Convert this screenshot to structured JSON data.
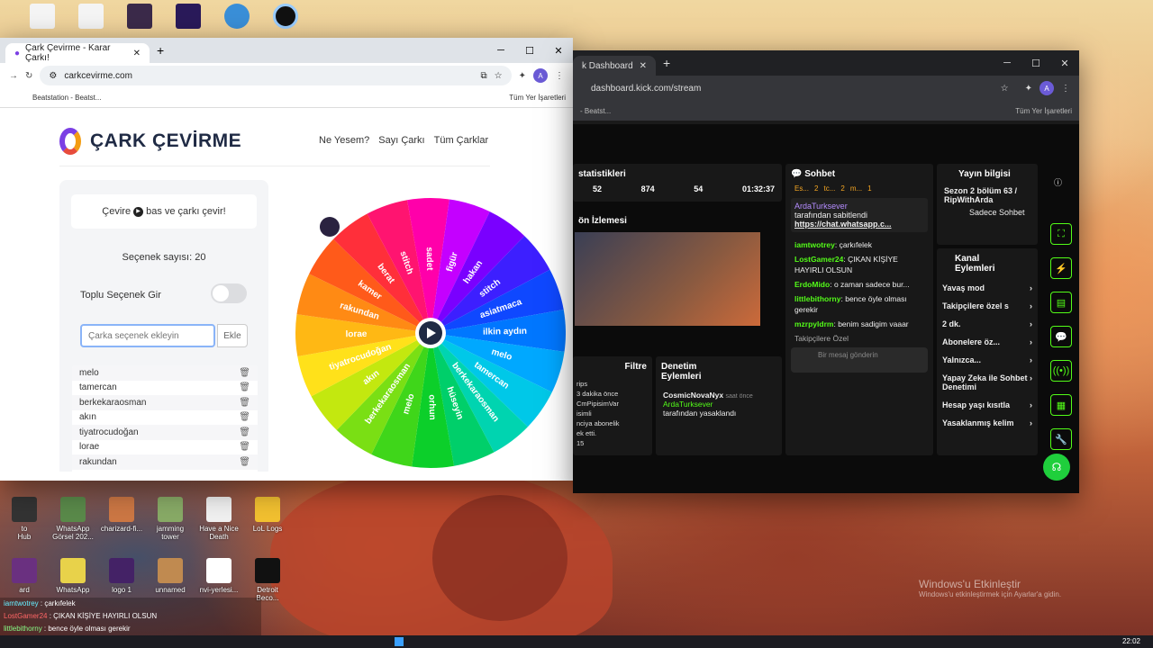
{
  "desktop": {
    "top_icons": [
      "",
      "",
      "",
      "",
      "",
      ""
    ],
    "row1": [
      {
        "label": "to\nHub"
      },
      {
        "label": "WhatsApp\nGörsel 202..."
      },
      {
        "label": "charizard-fi..."
      },
      {
        "label": "jamming\ntower"
      },
      {
        "label": "Have a Nice\nDeath"
      },
      {
        "label": "LoL Logs"
      }
    ],
    "row2": [
      {
        "label": "ard"
      },
      {
        "label": "WhatsApp"
      },
      {
        "label": "logo 1"
      },
      {
        "label": "unnamed"
      },
      {
        "label": "nvi-yerlesi..."
      },
      {
        "label": "Detroit\nBeco..."
      }
    ],
    "watermark_title": "Windows'u Etkinleştir",
    "watermark_sub": "Windows'u etkinleştirmek için Ayarlar'a gidin.",
    "clock": "22:02"
  },
  "stream_overlay": [
    {
      "user": "iamtwotrey",
      "msg": "çarkıfelek",
      "color": "#6ef"
    },
    {
      "user": "LostGamer24",
      "msg": "ÇIKAN KİŞİYE HAYIRLI OLSUN",
      "color": "#f66"
    },
    {
      "user": "littlebithorny",
      "msg": "bence öyle olması gerekir",
      "color": "#8f8"
    },
    {
      "user": "mzrpyldrm",
      "msg": "benim sadigim vaaar",
      "color": "#8cf"
    }
  ],
  "left_window": {
    "tab_title": "Çark Çevirme - Karar Çarkı!",
    "url": "carkcevirme.com",
    "bookmark": "Beatstation - Beatst...",
    "bookmarks_all": "Tüm Yer İşaretleri",
    "site": {
      "logo": "ÇARK ÇEVİRME",
      "nav": [
        "Ne Yesem?",
        "Sayı Çarkı",
        "Tüm Çarklar"
      ],
      "hint_before": "Çevire",
      "hint_after": "bas ve çarkı çevir!",
      "count": "Seçenek sayısı: 20",
      "bulk_label": "Toplu Seçenek Gir",
      "input_placeholder": "Çarka seçenek ekleyin",
      "add_button": "Ekle",
      "options": [
        "melo",
        "tamercan",
        "berkekaraosman",
        "akın",
        "tiyatrocudoğan",
        "lorae",
        "rakundan"
      ],
      "wheel_labels": [
        "sadet",
        "figür",
        "hakan",
        "stitch",
        "asiatmaca",
        "ilkin aydın",
        "melo",
        "tamercan",
        "berkekaraosman",
        "hüseyin",
        "orhun",
        "melo",
        "berkekaraosman",
        "akın",
        "tiyatrocudoğan",
        "lorae",
        "rakundan",
        "kamer",
        "berat",
        "stitch"
      ],
      "wheel_colors": [
        "#ff00aa",
        "#c400ff",
        "#7a00ff",
        "#3d1fff",
        "#0f48ff",
        "#0077ff",
        "#00a8ff",
        "#00c8e8",
        "#00d4b0",
        "#00cf6a",
        "#0ccf2a",
        "#3fd61a",
        "#7adf14",
        "#c3e80f",
        "#ffe11a",
        "#ffb814",
        "#ff8a14",
        "#ff5a1a",
        "#ff2f3a",
        "#ff1470"
      ]
    }
  },
  "right_window": {
    "tab_title": "k Dashboard",
    "url": "dashboard.kick.com/stream",
    "bookmark": "- Beatst...",
    "bookmarks_all": "Tüm Yer İşaretleri",
    "stats_title": "statistikleri",
    "stats": [
      "52",
      "874",
      "54",
      "01:32:37"
    ],
    "preview_title": "ön İzlemesi",
    "chat_title": "Sohbet",
    "chat_tabs": [
      "Es...",
      "2",
      "tc...",
      "2",
      "m...",
      "1"
    ],
    "pinned_user": "ArdaTurksever",
    "pinned_note": "tarafından sabitlendi",
    "pinned_link": "https://chat.whatsapp.c...",
    "chat": [
      {
        "user": "iamtwotrey",
        "msg": "çarkıfelek"
      },
      {
        "user": "LostGamer24",
        "msg": "ÇIKAN KİŞİYE HAYIRLI OLSUN"
      },
      {
        "user": "ErdoMido",
        "msg": "o zaman sadece bur..."
      },
      {
        "user": "littlebithorny",
        "msg": "bence öyle olması gerekir"
      },
      {
        "user": "mzrpyldrm",
        "msg": "benim sadigim vaaar"
      }
    ],
    "followers_only": "Takipçilere Özel",
    "chat_input": "Bir mesaj gönderin",
    "stream_info_title": "Yayın bilgisi",
    "stream_title": "Sezon 2 bölüm 63 / RipWithArda",
    "stream_cat": "Sadece Sohbet",
    "channel_actions": "Kanal Eylemleri",
    "actions": [
      "Yavaş mod",
      "Takipçilere özel s",
      "2 dk.",
      "Abonelere öz...",
      "Yalnızca...",
      "Yapay Zeka ile Sohbet Denetimi",
      "Hesap yaşı kısıtla",
      "Yasaklanmış kelim"
    ],
    "filter_label": "Filtre",
    "events": [
      "rips",
      "3 dakika önce",
      "CmPipisimVar",
      "isimli",
      "nciya abonelik",
      "ek etti.",
      "15"
    ],
    "mod_title": "Denetim Eylemleri",
    "mod_user": "CosmicNovaNyx",
    "mod_time": "saat önce",
    "mod_by": "ArdaTurksever",
    "mod_note": "tarafından yasaklandı"
  }
}
